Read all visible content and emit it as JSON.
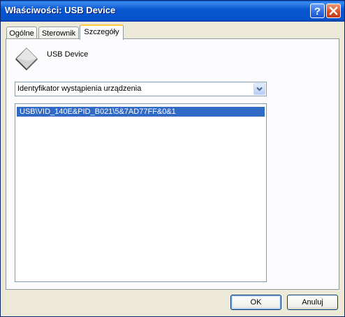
{
  "window": {
    "title": "Właściwości: USB Device"
  },
  "tabs": [
    {
      "label": "Ogólne",
      "active": false
    },
    {
      "label": "Sterownik",
      "active": false
    },
    {
      "label": "Szczegóły",
      "active": true
    }
  ],
  "details": {
    "device_name": "USB Device",
    "property_select": {
      "selected": "Identyfikator wystąpienia urządzenia"
    },
    "values": [
      {
        "text": "USB\\VID_140E&PID_B021\\5&7AD77FF&0&1",
        "selected": true
      }
    ]
  },
  "buttons": {
    "ok": "OK",
    "cancel": "Anuluj"
  },
  "colors": {
    "titlebar": "#0a58d0",
    "selection": "#316ac5",
    "active_tab_accent": "#ffc83c"
  },
  "icons": {
    "help": "help-icon",
    "close": "close-icon",
    "device": "usb-device-icon",
    "dropdown": "chevron-down-icon"
  }
}
